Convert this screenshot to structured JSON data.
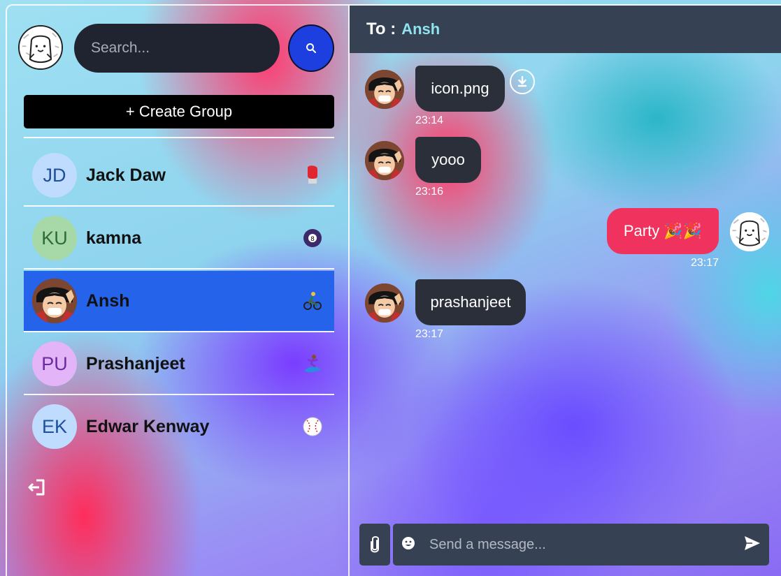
{
  "search": {
    "placeholder": "Search..."
  },
  "sidebar": {
    "create_group_label": "+ Create Group",
    "contacts": [
      {
        "initials": "JD",
        "name": "Jack Daw",
        "emoji": "🥊",
        "avatar_bg": "#bfdbfe",
        "avatar_fg": "#1e4f9c"
      },
      {
        "initials": "KU",
        "name": "kamna",
        "emoji": "🎱",
        "avatar_bg": "#a7d9a8",
        "avatar_fg": "#2f6b3a"
      },
      {
        "initials": "",
        "name": "Ansh",
        "emoji": "🚴",
        "avatar": "anime-avatar",
        "active": true
      },
      {
        "initials": "PU",
        "name": "Prashanjeet",
        "emoji": "🏄",
        "avatar_bg": "#e3b4f8",
        "avatar_fg": "#6b2a9e"
      },
      {
        "initials": "EK",
        "name": "Edwar Kenway",
        "emoji": "⚾",
        "avatar_bg": "#bfdbfe",
        "avatar_fg": "#1e4f9c"
      }
    ]
  },
  "chat": {
    "to_label": "To :",
    "to_name": "Ansh",
    "messages": [
      {
        "direction": "in",
        "text": "icon.png",
        "time": "23:14",
        "attachment": true
      },
      {
        "direction": "in",
        "text": "yooo",
        "time": "23:16"
      },
      {
        "direction": "out",
        "text": "Party 🎉🎉",
        "time": "23:17"
      },
      {
        "direction": "in",
        "text": "prashanjeet",
        "time": "23:17"
      }
    ],
    "input_placeholder": "Send a message..."
  },
  "colors": {
    "header": "#364153",
    "active_contact": "#2563eb",
    "outgoing_bubble": "#f0335e",
    "incoming_bubble": "#2b2f3a",
    "search_button": "#1d3fe0"
  }
}
